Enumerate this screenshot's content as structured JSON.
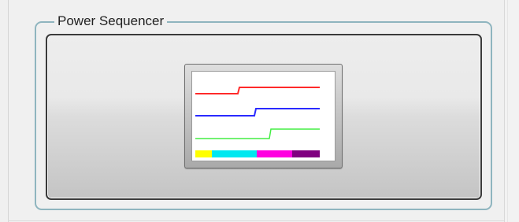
{
  "groupbox": {
    "title": "Power Sequencer"
  },
  "sequencer_button": {
    "icon": "power-sequence-timing-icon",
    "signal_colors": [
      "#ff2a2a",
      "#2a2aff",
      "#44ee44"
    ],
    "bar_colors": [
      "#ffff00",
      "#00e8f0",
      "#ff00e0",
      "#800080"
    ]
  }
}
